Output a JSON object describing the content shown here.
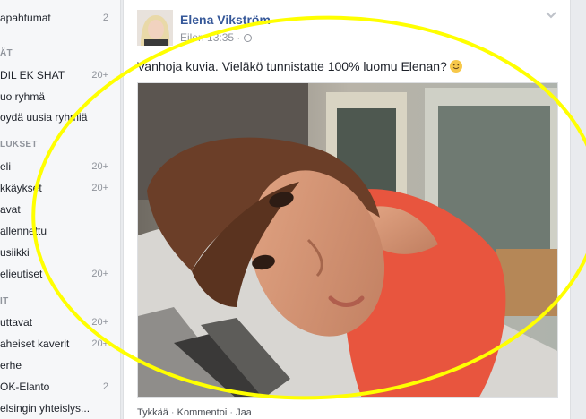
{
  "sidebar": {
    "rows": [
      {
        "label": "apahtumat",
        "count": "2",
        "kind": "item"
      },
      {
        "label": "ÄT",
        "count": "",
        "kind": "head"
      },
      {
        "label": "DIL EK SHAT",
        "count": "20+",
        "kind": "item"
      },
      {
        "label": "uo ryhmä",
        "count": "",
        "kind": "item"
      },
      {
        "label": "oydä uusia ryhmiä",
        "count": "",
        "kind": "item"
      },
      {
        "label": "LUKSET",
        "count": "",
        "kind": "head"
      },
      {
        "label": "eli",
        "count": "20+",
        "kind": "item"
      },
      {
        "label": "kkäykset",
        "count": "20+",
        "kind": "item"
      },
      {
        "label": "avat",
        "count": "",
        "kind": "item"
      },
      {
        "label": "allennettu",
        "count": "",
        "kind": "item"
      },
      {
        "label": "usiikki",
        "count": "",
        "kind": "item"
      },
      {
        "label": "elieutiset",
        "count": "20+",
        "kind": "item"
      },
      {
        "label": "IT",
        "count": "",
        "kind": "head"
      },
      {
        "label": "uttavat",
        "count": "20+",
        "kind": "item"
      },
      {
        "label": "aheiset kaverit",
        "count": "20+",
        "kind": "item"
      },
      {
        "label": "erhe",
        "count": "",
        "kind": "item"
      },
      {
        "label": "OK-Elanto",
        "count": "2",
        "kind": "item"
      },
      {
        "label": "elsingin yhteislys...",
        "count": "",
        "kind": "item"
      }
    ]
  },
  "post": {
    "author": "Elena Vikström",
    "time": "Eilen 13:35 ·",
    "text": "Vanhoja kuvia. Vieläkö tunnistatte 100% luomu Elenan?",
    "actions": {
      "like": "Tykkää",
      "sep": " · ",
      "comment": "Kommentoi",
      "share": "Jaa"
    }
  },
  "colors": {
    "link": "#365899",
    "annotation": "#ffff00",
    "shirt": "#e8553e"
  },
  "icons": {
    "privacy": "globe-icon",
    "menu": "chevron-down-icon",
    "emoji": "smile-emoji-icon"
  }
}
